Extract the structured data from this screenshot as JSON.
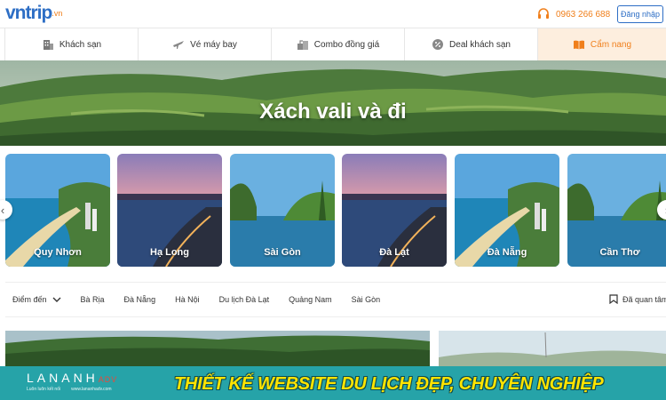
{
  "header": {
    "logo_main": "vntrip",
    "logo_tld": ".vn",
    "phone": "0963 266 688",
    "login_label": "Đăng nhập"
  },
  "nav": {
    "tabs": [
      {
        "label": "Khách sạn",
        "icon": "hotel-icon"
      },
      {
        "label": "Vé máy bay",
        "icon": "plane-icon"
      },
      {
        "label": "Combo đồng giá",
        "icon": "combo-icon"
      },
      {
        "label": "Deal khách sạn",
        "icon": "discount-icon"
      },
      {
        "label": "Cẩm nang",
        "icon": "book-icon",
        "active": true
      }
    ]
  },
  "hero": {
    "title": "Xách vali và đi"
  },
  "destinations": [
    {
      "label": "Quy Nhơn"
    },
    {
      "label": "Hạ Long"
    },
    {
      "label": "Sài Gòn"
    },
    {
      "label": "Đà Lạt"
    },
    {
      "label": "Đà Nẵng"
    },
    {
      "label": "Cần Thơ"
    }
  ],
  "filter": {
    "dropdown_label": "Điểm đến",
    "links": [
      "Bà Rịa",
      "Đà Nẵng",
      "Hà Nội",
      "Du lịch Đà Lạt",
      "Quảng Nam",
      "Sài Gòn"
    ],
    "saved_label": "Đã quan tâm"
  },
  "banner": {
    "brand": "LANANH",
    "brand_suffix": "ADV",
    "tagline": "Luôn luôn kết nối",
    "url": "www.lananhadv.com",
    "title": "THIẾT KẾ WEBSITE DU LỊCH ĐẸP, CHUYÊN NGHIỆP"
  },
  "colors": {
    "brand_blue": "#2d6ec5",
    "accent_orange": "#f07f1b",
    "banner_teal": "#26a3a8",
    "banner_title": "#ffe400"
  }
}
